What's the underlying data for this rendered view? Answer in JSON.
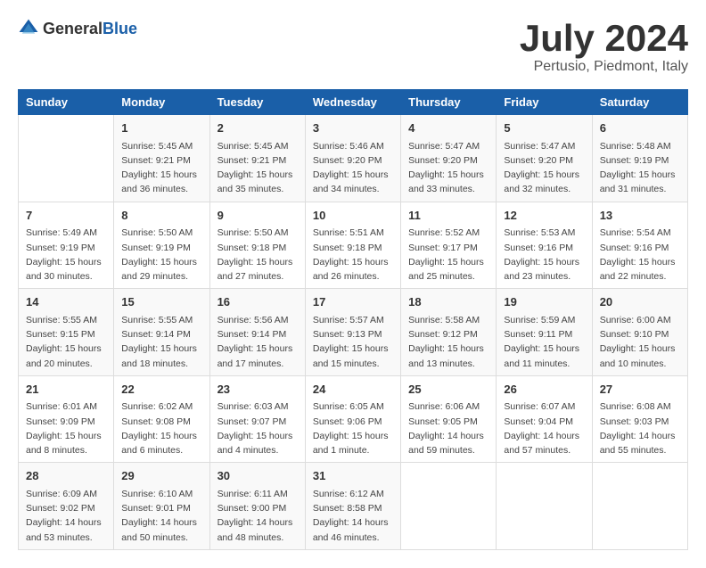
{
  "header": {
    "logo_general": "General",
    "logo_blue": "Blue",
    "title": "July 2024",
    "subtitle": "Pertusio, Piedmont, Italy"
  },
  "calendar": {
    "days_of_week": [
      "Sunday",
      "Monday",
      "Tuesday",
      "Wednesday",
      "Thursday",
      "Friday",
      "Saturday"
    ],
    "weeks": [
      [
        {
          "day": "",
          "info": ""
        },
        {
          "day": "1",
          "info": "Sunrise: 5:45 AM\nSunset: 9:21 PM\nDaylight: 15 hours\nand 36 minutes."
        },
        {
          "day": "2",
          "info": "Sunrise: 5:45 AM\nSunset: 9:21 PM\nDaylight: 15 hours\nand 35 minutes."
        },
        {
          "day": "3",
          "info": "Sunrise: 5:46 AM\nSunset: 9:20 PM\nDaylight: 15 hours\nand 34 minutes."
        },
        {
          "day": "4",
          "info": "Sunrise: 5:47 AM\nSunset: 9:20 PM\nDaylight: 15 hours\nand 33 minutes."
        },
        {
          "day": "5",
          "info": "Sunrise: 5:47 AM\nSunset: 9:20 PM\nDaylight: 15 hours\nand 32 minutes."
        },
        {
          "day": "6",
          "info": "Sunrise: 5:48 AM\nSunset: 9:19 PM\nDaylight: 15 hours\nand 31 minutes."
        }
      ],
      [
        {
          "day": "7",
          "info": "Sunrise: 5:49 AM\nSunset: 9:19 PM\nDaylight: 15 hours\nand 30 minutes."
        },
        {
          "day": "8",
          "info": "Sunrise: 5:50 AM\nSunset: 9:19 PM\nDaylight: 15 hours\nand 29 minutes."
        },
        {
          "day": "9",
          "info": "Sunrise: 5:50 AM\nSunset: 9:18 PM\nDaylight: 15 hours\nand 27 minutes."
        },
        {
          "day": "10",
          "info": "Sunrise: 5:51 AM\nSunset: 9:18 PM\nDaylight: 15 hours\nand 26 minutes."
        },
        {
          "day": "11",
          "info": "Sunrise: 5:52 AM\nSunset: 9:17 PM\nDaylight: 15 hours\nand 25 minutes."
        },
        {
          "day": "12",
          "info": "Sunrise: 5:53 AM\nSunset: 9:16 PM\nDaylight: 15 hours\nand 23 minutes."
        },
        {
          "day": "13",
          "info": "Sunrise: 5:54 AM\nSunset: 9:16 PM\nDaylight: 15 hours\nand 22 minutes."
        }
      ],
      [
        {
          "day": "14",
          "info": "Sunrise: 5:55 AM\nSunset: 9:15 PM\nDaylight: 15 hours\nand 20 minutes."
        },
        {
          "day": "15",
          "info": "Sunrise: 5:55 AM\nSunset: 9:14 PM\nDaylight: 15 hours\nand 18 minutes."
        },
        {
          "day": "16",
          "info": "Sunrise: 5:56 AM\nSunset: 9:14 PM\nDaylight: 15 hours\nand 17 minutes."
        },
        {
          "day": "17",
          "info": "Sunrise: 5:57 AM\nSunset: 9:13 PM\nDaylight: 15 hours\nand 15 minutes."
        },
        {
          "day": "18",
          "info": "Sunrise: 5:58 AM\nSunset: 9:12 PM\nDaylight: 15 hours\nand 13 minutes."
        },
        {
          "day": "19",
          "info": "Sunrise: 5:59 AM\nSunset: 9:11 PM\nDaylight: 15 hours\nand 11 minutes."
        },
        {
          "day": "20",
          "info": "Sunrise: 6:00 AM\nSunset: 9:10 PM\nDaylight: 15 hours\nand 10 minutes."
        }
      ],
      [
        {
          "day": "21",
          "info": "Sunrise: 6:01 AM\nSunset: 9:09 PM\nDaylight: 15 hours\nand 8 minutes."
        },
        {
          "day": "22",
          "info": "Sunrise: 6:02 AM\nSunset: 9:08 PM\nDaylight: 15 hours\nand 6 minutes."
        },
        {
          "day": "23",
          "info": "Sunrise: 6:03 AM\nSunset: 9:07 PM\nDaylight: 15 hours\nand 4 minutes."
        },
        {
          "day": "24",
          "info": "Sunrise: 6:05 AM\nSunset: 9:06 PM\nDaylight: 15 hours\nand 1 minute."
        },
        {
          "day": "25",
          "info": "Sunrise: 6:06 AM\nSunset: 9:05 PM\nDaylight: 14 hours\nand 59 minutes."
        },
        {
          "day": "26",
          "info": "Sunrise: 6:07 AM\nSunset: 9:04 PM\nDaylight: 14 hours\nand 57 minutes."
        },
        {
          "day": "27",
          "info": "Sunrise: 6:08 AM\nSunset: 9:03 PM\nDaylight: 14 hours\nand 55 minutes."
        }
      ],
      [
        {
          "day": "28",
          "info": "Sunrise: 6:09 AM\nSunset: 9:02 PM\nDaylight: 14 hours\nand 53 minutes."
        },
        {
          "day": "29",
          "info": "Sunrise: 6:10 AM\nSunset: 9:01 PM\nDaylight: 14 hours\nand 50 minutes."
        },
        {
          "day": "30",
          "info": "Sunrise: 6:11 AM\nSunset: 9:00 PM\nDaylight: 14 hours\nand 48 minutes."
        },
        {
          "day": "31",
          "info": "Sunrise: 6:12 AM\nSunset: 8:58 PM\nDaylight: 14 hours\nand 46 minutes."
        },
        {
          "day": "",
          "info": ""
        },
        {
          "day": "",
          "info": ""
        },
        {
          "day": "",
          "info": ""
        }
      ]
    ]
  }
}
